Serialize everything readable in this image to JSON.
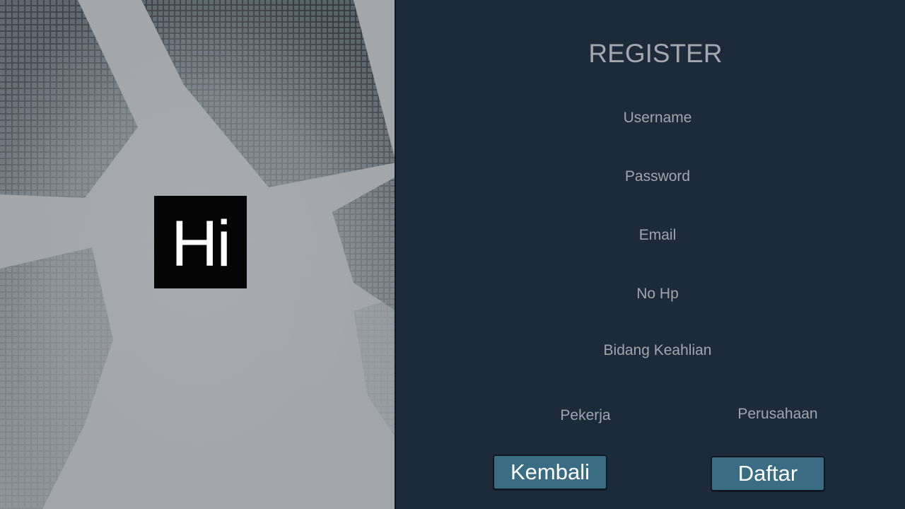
{
  "brand": {
    "logo_text": "Hi"
  },
  "form": {
    "title": "REGISTER",
    "fields": [
      {
        "label": "Username"
      },
      {
        "label": "Password"
      },
      {
        "label": "Email"
      },
      {
        "label": "No Hp"
      },
      {
        "label": "Bidang Keahlian"
      }
    ],
    "roles": [
      {
        "label": "Pekerja"
      },
      {
        "label": "Perusahaan"
      }
    ],
    "buttons": {
      "back_label": "Kembali",
      "submit_label": "Daftar"
    }
  },
  "colors": {
    "background": "#1d2a39",
    "button": "#3a6d83",
    "text_muted": "#a0a6ac"
  }
}
